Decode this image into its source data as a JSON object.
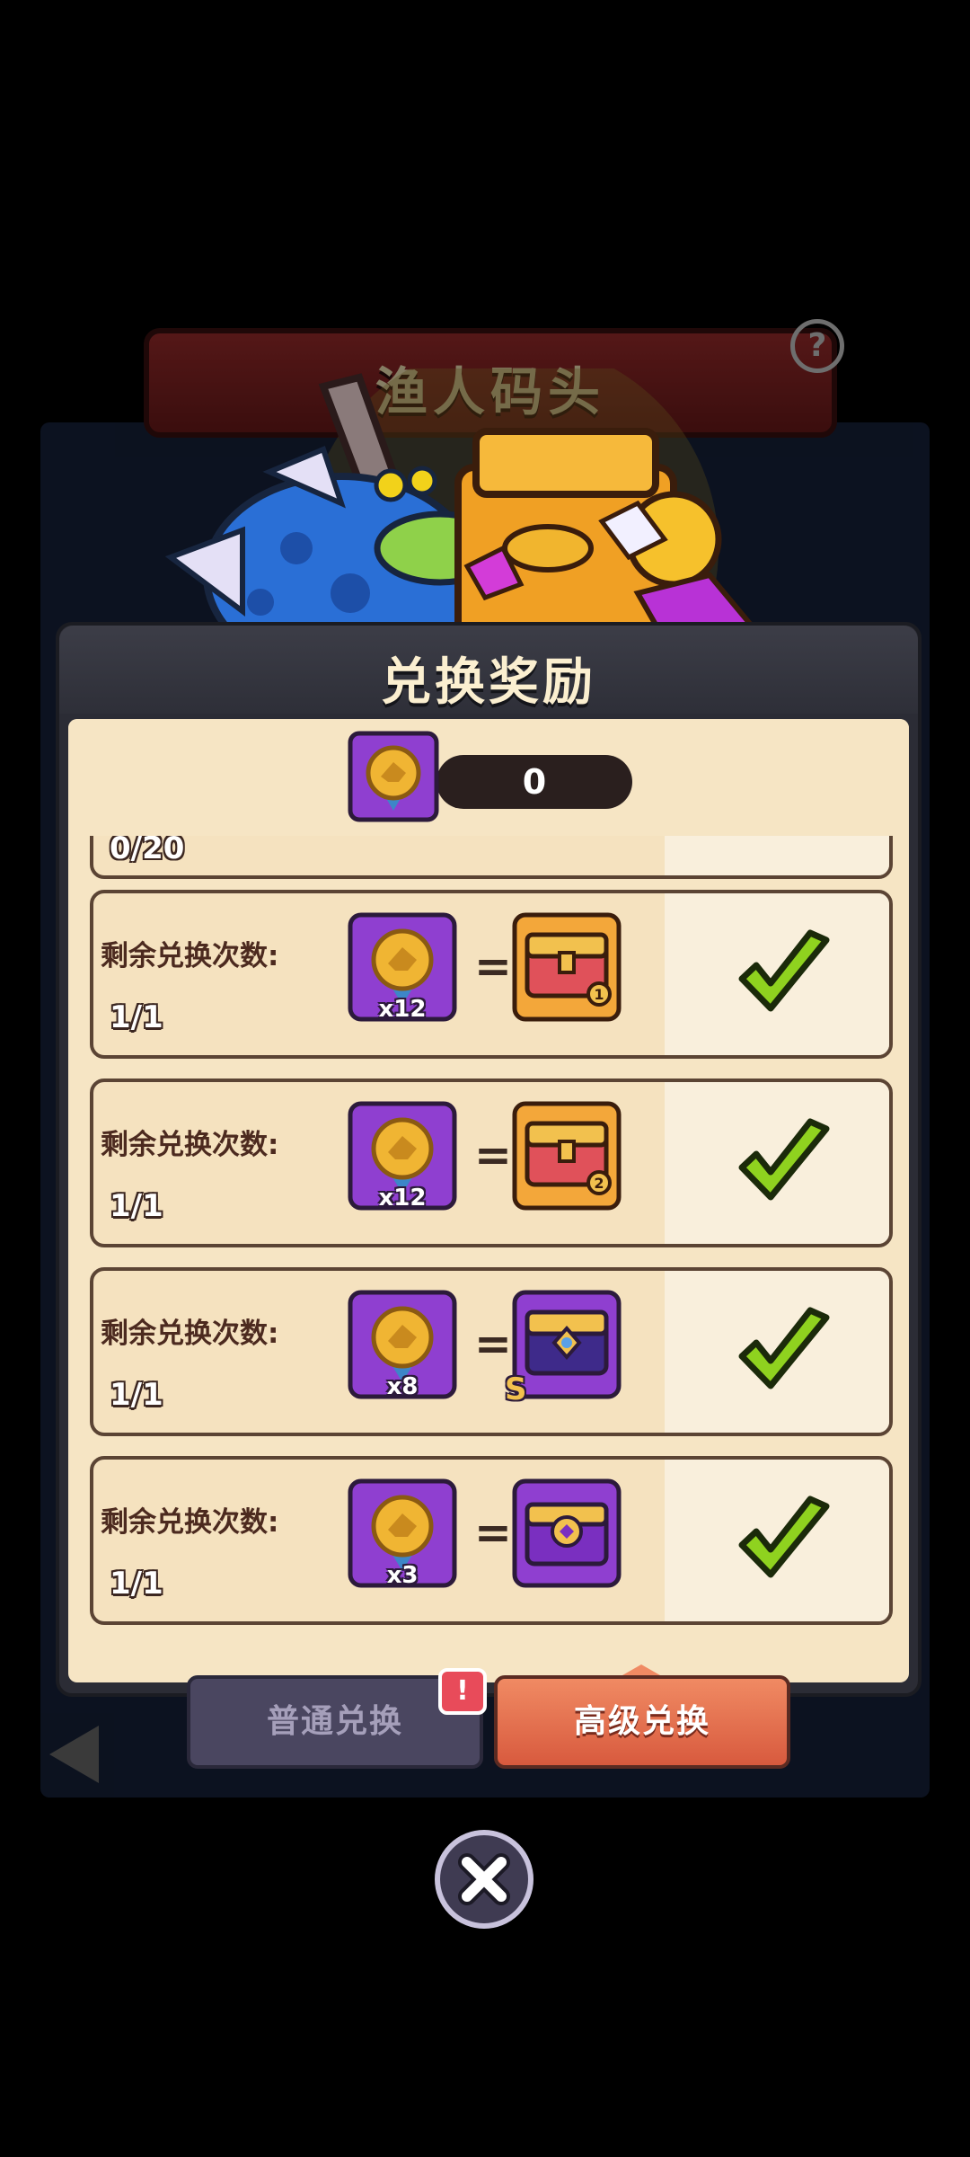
{
  "background": {
    "location_title": "渔人码头",
    "help_icon": "question-icon"
  },
  "dialog": {
    "title": "兑换奖励",
    "currency": {
      "icon": "wolf-medal-icon",
      "value": "0"
    },
    "partial_row": {
      "count": "0/20"
    },
    "rows": [
      {
        "label": "剩余兑换次数:",
        "count": "1/1",
        "token_qty": "x12",
        "reward_icon": "chest-1-icon",
        "status_icon": "check-icon"
      },
      {
        "label": "剩余兑换次数:",
        "count": "1/1",
        "token_qty": "x12",
        "reward_icon": "chest-2-icon",
        "status_icon": "check-icon"
      },
      {
        "label": "剩余兑换次数:",
        "count": "1/1",
        "token_qty": "x8",
        "reward_icon": "chest-s-icon",
        "reward_badge": "S",
        "status_icon": "check-icon"
      },
      {
        "label": "剩余兑换次数:",
        "count": "1/1",
        "token_qty": "x3",
        "reward_icon": "chest-purple-icon",
        "status_icon": "check-icon"
      }
    ]
  },
  "tabs": {
    "normal_label": "普通兑换",
    "advanced_label": "高级兑换",
    "alert": "!"
  },
  "close_icon": "close-icon",
  "colors": {
    "panel": "#f6e5c4",
    "header": "#2e2f38",
    "accent": "#d85a3e",
    "token_purple": "#8f3fd0",
    "check_green": "#8fd21f"
  }
}
